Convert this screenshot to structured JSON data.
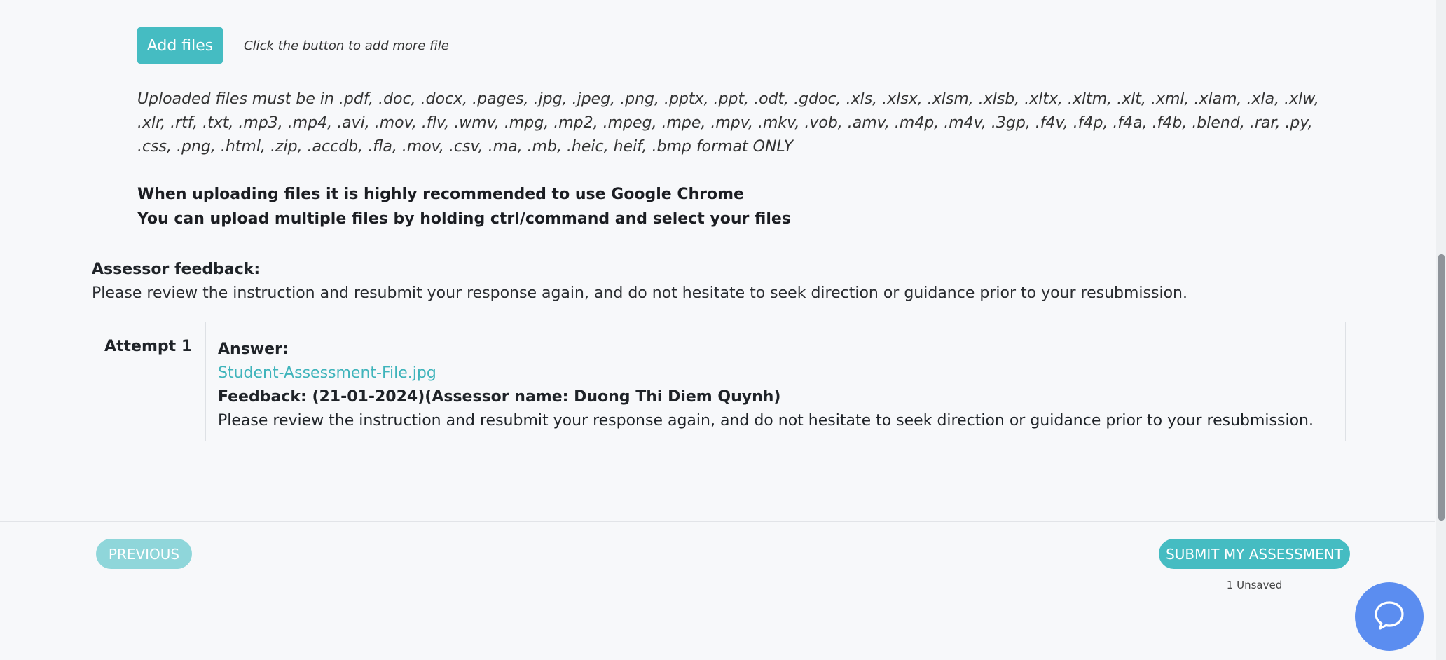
{
  "upload": {
    "add_button_label": "Add files",
    "add_hint": "Click the button to add more file",
    "formats_text": "Uploaded files must be in .pdf, .doc, .docx, .pages, .jpg, .jpeg, .png, .pptx, .ppt, .odt, .gdoc, .xls, .xlsx, .xlsm, .xlsb, .xltx, .xltm, .xlt, .xml, .xlam, .xla, .xlw, .xlr, .rtf, .txt, .mp3, .mp4, .avi, .mov, .flv, .wmv, .mpg, .mp2, .mpeg, .mpe, .mpv, .mkv, .vob, .amv, .m4p, .m4v, .3gp, .f4v, .f4p, .f4a, .f4b, .blend, .rar, .py, .css, .png, .html, .zip, .accdb, .fla, .mov, .csv, .ma, .mb, .heic, heif, .bmp format ONLY",
    "note_chrome": "When uploading files it is highly recommended to use Google Chrome",
    "note_multiple": "You can upload multiple files by holding ctrl/command and select your files"
  },
  "assessor_feedback": {
    "heading": "Assessor feedback:",
    "text": "Please review the instruction and resubmit your response again, and do not hesitate to seek direction or guidance prior to your resubmission."
  },
  "attempts": [
    {
      "label": "Attempt 1",
      "answer_label": "Answer:",
      "file_name": "Student-Assessment-File.jpg",
      "feedback_header": "Feedback: (21-01-2024)(Assessor name: Duong Thi Diem Quynh)",
      "feedback_text": "Please review the instruction and resubmit your response again, and do not hesitate to seek direction or guidance prior to your resubmission."
    }
  ],
  "footer": {
    "previous_label": "PREVIOUS",
    "submit_label": "SUBMIT MY ASSESSMENT",
    "unsaved_text": "1 Unsaved"
  },
  "colors": {
    "accent": "#45bcc2",
    "accent_disabled": "#8fd6da",
    "chat_button": "#5b8df0"
  },
  "icons": {
    "chat": "chat-bubble-icon"
  }
}
